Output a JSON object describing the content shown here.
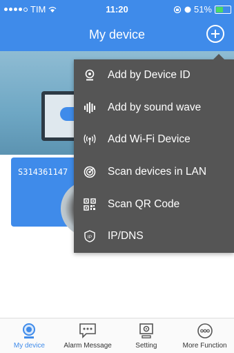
{
  "status_bar": {
    "carrier": "TIM",
    "time": "11:20",
    "battery": "51%",
    "battery_level": 0.51
  },
  "header": {
    "title": "My device"
  },
  "device_card": {
    "id": "S314361147"
  },
  "menu": {
    "items": [
      {
        "label": "Add by Device ID",
        "icon": "device-id-icon"
      },
      {
        "label": "Add by sound wave",
        "icon": "sound-wave-icon"
      },
      {
        "label": "Add Wi-Fi Device",
        "icon": "wifi-device-icon"
      },
      {
        "label": "Scan devices in LAN",
        "icon": "lan-scan-icon"
      },
      {
        "label": "Scan QR Code",
        "icon": "qr-code-icon"
      },
      {
        "label": "IP/DNS",
        "icon": "ip-dns-icon"
      }
    ]
  },
  "tabs": [
    {
      "label": "My device",
      "icon": "my-device-icon",
      "active": true
    },
    {
      "label": "Alarm Message",
      "icon": "alarm-message-icon",
      "active": false
    },
    {
      "label": "Setting",
      "icon": "setting-icon",
      "active": false
    },
    {
      "label": "More Function",
      "icon": "more-function-icon",
      "active": false
    }
  ],
  "colors": {
    "accent": "#3f8bea",
    "menu_bg": "#555555"
  }
}
